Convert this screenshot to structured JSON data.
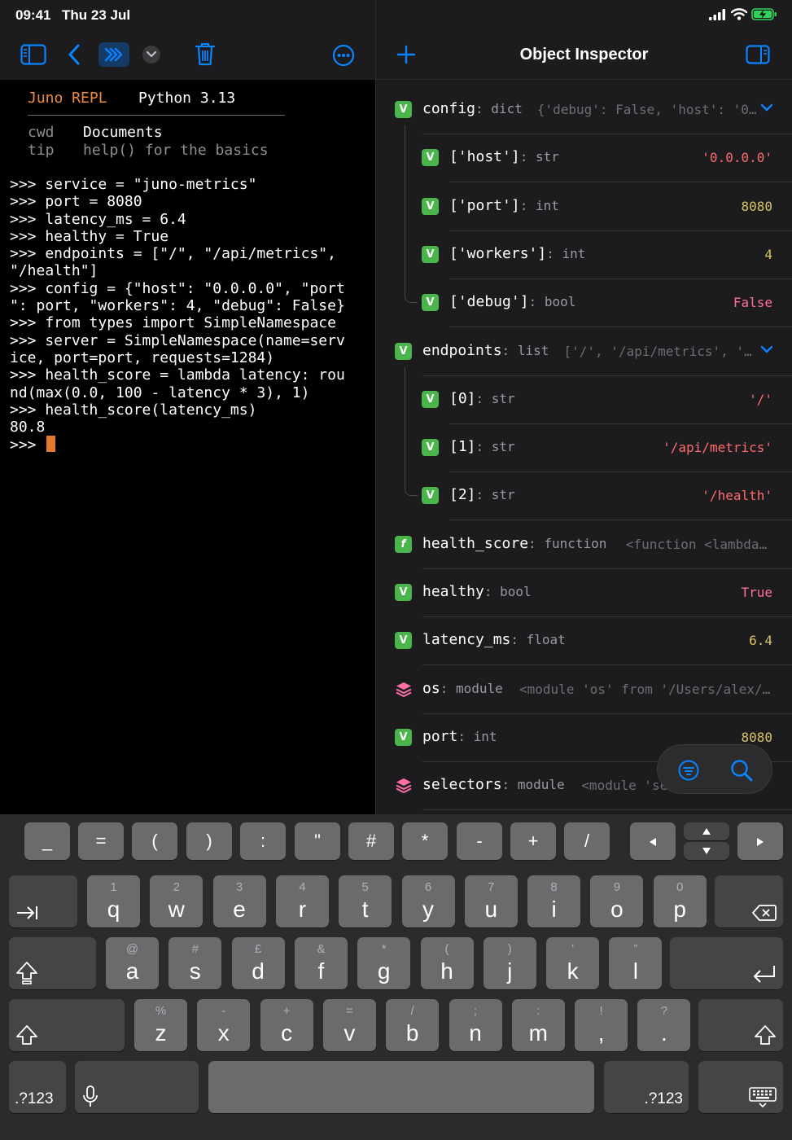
{
  "status": {
    "time": "09:41",
    "date": "Thu 23 Jul"
  },
  "repl": {
    "name": "Juno REPL",
    "version": "Python 3.13",
    "meta": [
      {
        "key": "cwd",
        "value": "Documents"
      },
      {
        "key": "tip",
        "value": "help() for the basics"
      }
    ],
    "lines": [
      ">>> service = \"juno-metrics\"",
      ">>> port = 8080",
      ">>> latency_ms = 6.4",
      ">>> healthy = True",
      ">>> endpoints = [\"/\", \"/api/metrics\",",
      "\"/health\"]",
      ">>> config = {\"host\": \"0.0.0.0\", \"port",
      "\": port, \"workers\": 4, \"debug\": False}",
      ">>> from types import SimpleNamespace",
      ">>> server = SimpleNamespace(name=serv",
      "ice, port=port, requests=1284)",
      ">>> health_score = lambda latency: rou",
      "nd(max(0.0, 100 - latency * 3), 1)",
      ">>> health_score(latency_ms)",
      "80.8"
    ],
    "prompt": ">>> "
  },
  "inspector": {
    "title": "Object Inspector",
    "rows": [
      {
        "name": "config",
        "type": "dict",
        "preview": "{'debug': False, 'host': '0…",
        "badge": "V",
        "expanded": true
      },
      {
        "name": "['host']",
        "type": "str",
        "value": "'0.0.0.0'",
        "badge": "V",
        "kind": "str",
        "child": true
      },
      {
        "name": "['port']",
        "type": "int",
        "value": "8080",
        "badge": "V",
        "kind": "num",
        "child": true
      },
      {
        "name": "['workers']",
        "type": "int",
        "value": "4",
        "badge": "V",
        "kind": "num",
        "child": true
      },
      {
        "name": "['debug']",
        "type": "bool",
        "value": "False",
        "badge": "V",
        "kind": "bool",
        "child": true
      },
      {
        "name": "endpoints",
        "type": "list",
        "preview": "['/', '/api/metrics', '…",
        "badge": "V",
        "expanded": true
      },
      {
        "name": "[0]",
        "type": "str",
        "value": "'/'",
        "badge": "V",
        "kind": "str",
        "child": true
      },
      {
        "name": "[1]",
        "type": "str",
        "value": "'/api/metrics'",
        "badge": "V",
        "kind": "str",
        "child": true
      },
      {
        "name": "[2]",
        "type": "str",
        "value": "'/health'",
        "badge": "V",
        "kind": "str",
        "child": true
      },
      {
        "name": "health_score",
        "type": "function",
        "preview": "<function <lambda>…",
        "badge": "f"
      },
      {
        "name": "healthy",
        "type": "bool",
        "value": "True",
        "badge": "V",
        "kind": "bool"
      },
      {
        "name": "latency_ms",
        "type": "float",
        "value": "6.4",
        "badge": "V",
        "kind": "num"
      },
      {
        "name": "os",
        "type": "module",
        "preview": "<module 'os' from '/Users/alex/L…",
        "badge": "module"
      },
      {
        "name": "port",
        "type": "int",
        "value": "8080",
        "badge": "V",
        "kind": "num"
      },
      {
        "name": "selectors",
        "type": "module",
        "preview": "<module 'se…",
        "badge": "module"
      }
    ]
  },
  "keyboard": {
    "symbols": [
      "_",
      "=",
      "(",
      ")",
      ":",
      "\"",
      "#",
      "*",
      "-",
      "+",
      "/"
    ],
    "row1": [
      {
        "main": "q",
        "sub": "1"
      },
      {
        "main": "w",
        "sub": "2"
      },
      {
        "main": "e",
        "sub": "3"
      },
      {
        "main": "r",
        "sub": "4"
      },
      {
        "main": "t",
        "sub": "5"
      },
      {
        "main": "y",
        "sub": "6"
      },
      {
        "main": "u",
        "sub": "7"
      },
      {
        "main": "i",
        "sub": "8"
      },
      {
        "main": "o",
        "sub": "9"
      },
      {
        "main": "p",
        "sub": "0"
      }
    ],
    "row2": [
      {
        "main": "a",
        "sub": "@"
      },
      {
        "main": "s",
        "sub": "#"
      },
      {
        "main": "d",
        "sub": "£"
      },
      {
        "main": "f",
        "sub": "&"
      },
      {
        "main": "g",
        "sub": "*"
      },
      {
        "main": "h",
        "sub": "("
      },
      {
        "main": "j",
        "sub": ")"
      },
      {
        "main": "k",
        "sub": "’"
      },
      {
        "main": "l",
        "sub": "”"
      }
    ],
    "row3": [
      {
        "main": "z",
        "sub": "%"
      },
      {
        "main": "x",
        "sub": "-"
      },
      {
        "main": "c",
        "sub": "+"
      },
      {
        "main": "v",
        "sub": "="
      },
      {
        "main": "b",
        "sub": "/"
      },
      {
        "main": "n",
        "sub": ";"
      },
      {
        "main": "m",
        "sub": ":"
      },
      {
        "main": ",",
        "sub": "!"
      },
      {
        "main": ".",
        "sub": "?"
      }
    ],
    "numbers_label": ".?123"
  },
  "colors": {
    "accent": "#0a84ff",
    "orange": "#ef8a3d",
    "badge_green": "#4bb54b"
  }
}
